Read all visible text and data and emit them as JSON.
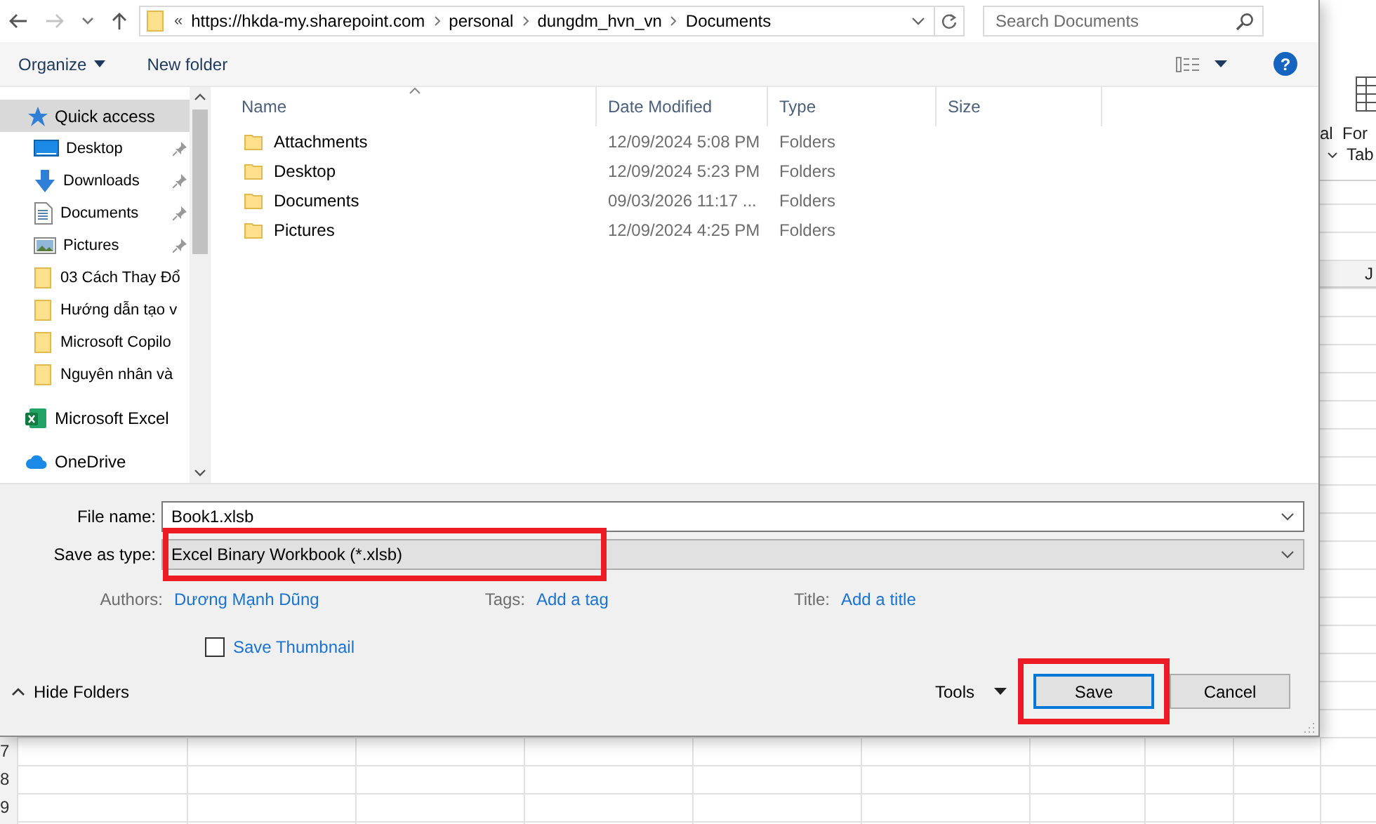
{
  "address": {
    "overflow": "«",
    "crumbs": [
      "https://hkda-my.sharepoint.com",
      "personal",
      "dungdm_hvn_vn",
      "Documents"
    ]
  },
  "search": {
    "placeholder": "Search Documents"
  },
  "toolbar": {
    "organize": "Organize",
    "new_folder": "New folder",
    "help": "?"
  },
  "sidebar": {
    "items": [
      {
        "label": "Quick access",
        "kind": "star",
        "selected": true,
        "pinned": false
      },
      {
        "label": "Desktop",
        "kind": "desktop",
        "selected": false,
        "pinned": true
      },
      {
        "label": "Downloads",
        "kind": "download",
        "selected": false,
        "pinned": true
      },
      {
        "label": "Documents",
        "kind": "document",
        "selected": false,
        "pinned": true
      },
      {
        "label": "Pictures",
        "kind": "picture",
        "selected": false,
        "pinned": true
      },
      {
        "label": "03 Cách Thay Đổ",
        "kind": "folder",
        "selected": false,
        "pinned": false
      },
      {
        "label": "Hướng dẫn tạo v",
        "kind": "folder",
        "selected": false,
        "pinned": false
      },
      {
        "label": "Microsoft Copilo",
        "kind": "folder",
        "selected": false,
        "pinned": false
      },
      {
        "label": "Nguyên nhân và",
        "kind": "folder",
        "selected": false,
        "pinned": false
      },
      {
        "label": "Microsoft Excel",
        "kind": "excel",
        "selected": false,
        "pinned": false
      },
      {
        "label": "OneDrive",
        "kind": "cloud",
        "selected": false,
        "pinned": false
      }
    ]
  },
  "table": {
    "columns": [
      {
        "label": "Name",
        "sorted": true
      },
      {
        "label": "Date Modified",
        "sorted": false
      },
      {
        "label": "Type",
        "sorted": false
      },
      {
        "label": "Size",
        "sorted": false
      }
    ],
    "rows": [
      {
        "name": "Attachments",
        "date": "12/09/2024 5:08 PM",
        "type": "Folders"
      },
      {
        "name": "Desktop",
        "date": "12/09/2024 5:23 PM",
        "type": "Folders"
      },
      {
        "name": "Documents",
        "date": "09/03/2026 11:17 ...",
        "type": "Folders"
      },
      {
        "name": "Pictures",
        "date": "12/09/2024 4:25 PM",
        "type": "Folders"
      }
    ]
  },
  "form": {
    "file_name": {
      "label": "File name:",
      "value": "Book1.xlsb"
    },
    "file_type": {
      "label": "Save as type:",
      "value": "Excel Binary Workbook (*.xlsb)",
      "highlighted": true
    },
    "authors": {
      "label": "Authors:",
      "value": "Dương Mạnh Dũng"
    },
    "tags": {
      "label": "Tags:",
      "value": "Add a tag"
    },
    "title": {
      "label": "Title:",
      "value": "Add a title"
    },
    "thumbnail": {
      "label": "Save Thumbnail",
      "checked": false
    }
  },
  "footer": {
    "hide_folders": "Hide Folders",
    "tools": "Tools",
    "buttons": [
      {
        "label": "Save",
        "kind": "primary",
        "highlighted": true
      },
      {
        "label": "Cancel",
        "kind": "secondary",
        "highlighted": false
      }
    ]
  },
  "excel_background": {
    "ribbon_texts": [
      "al",
      "For",
      "Tab"
    ],
    "column_header": "J",
    "row_numbers": [
      "7",
      "8",
      "9"
    ]
  }
}
